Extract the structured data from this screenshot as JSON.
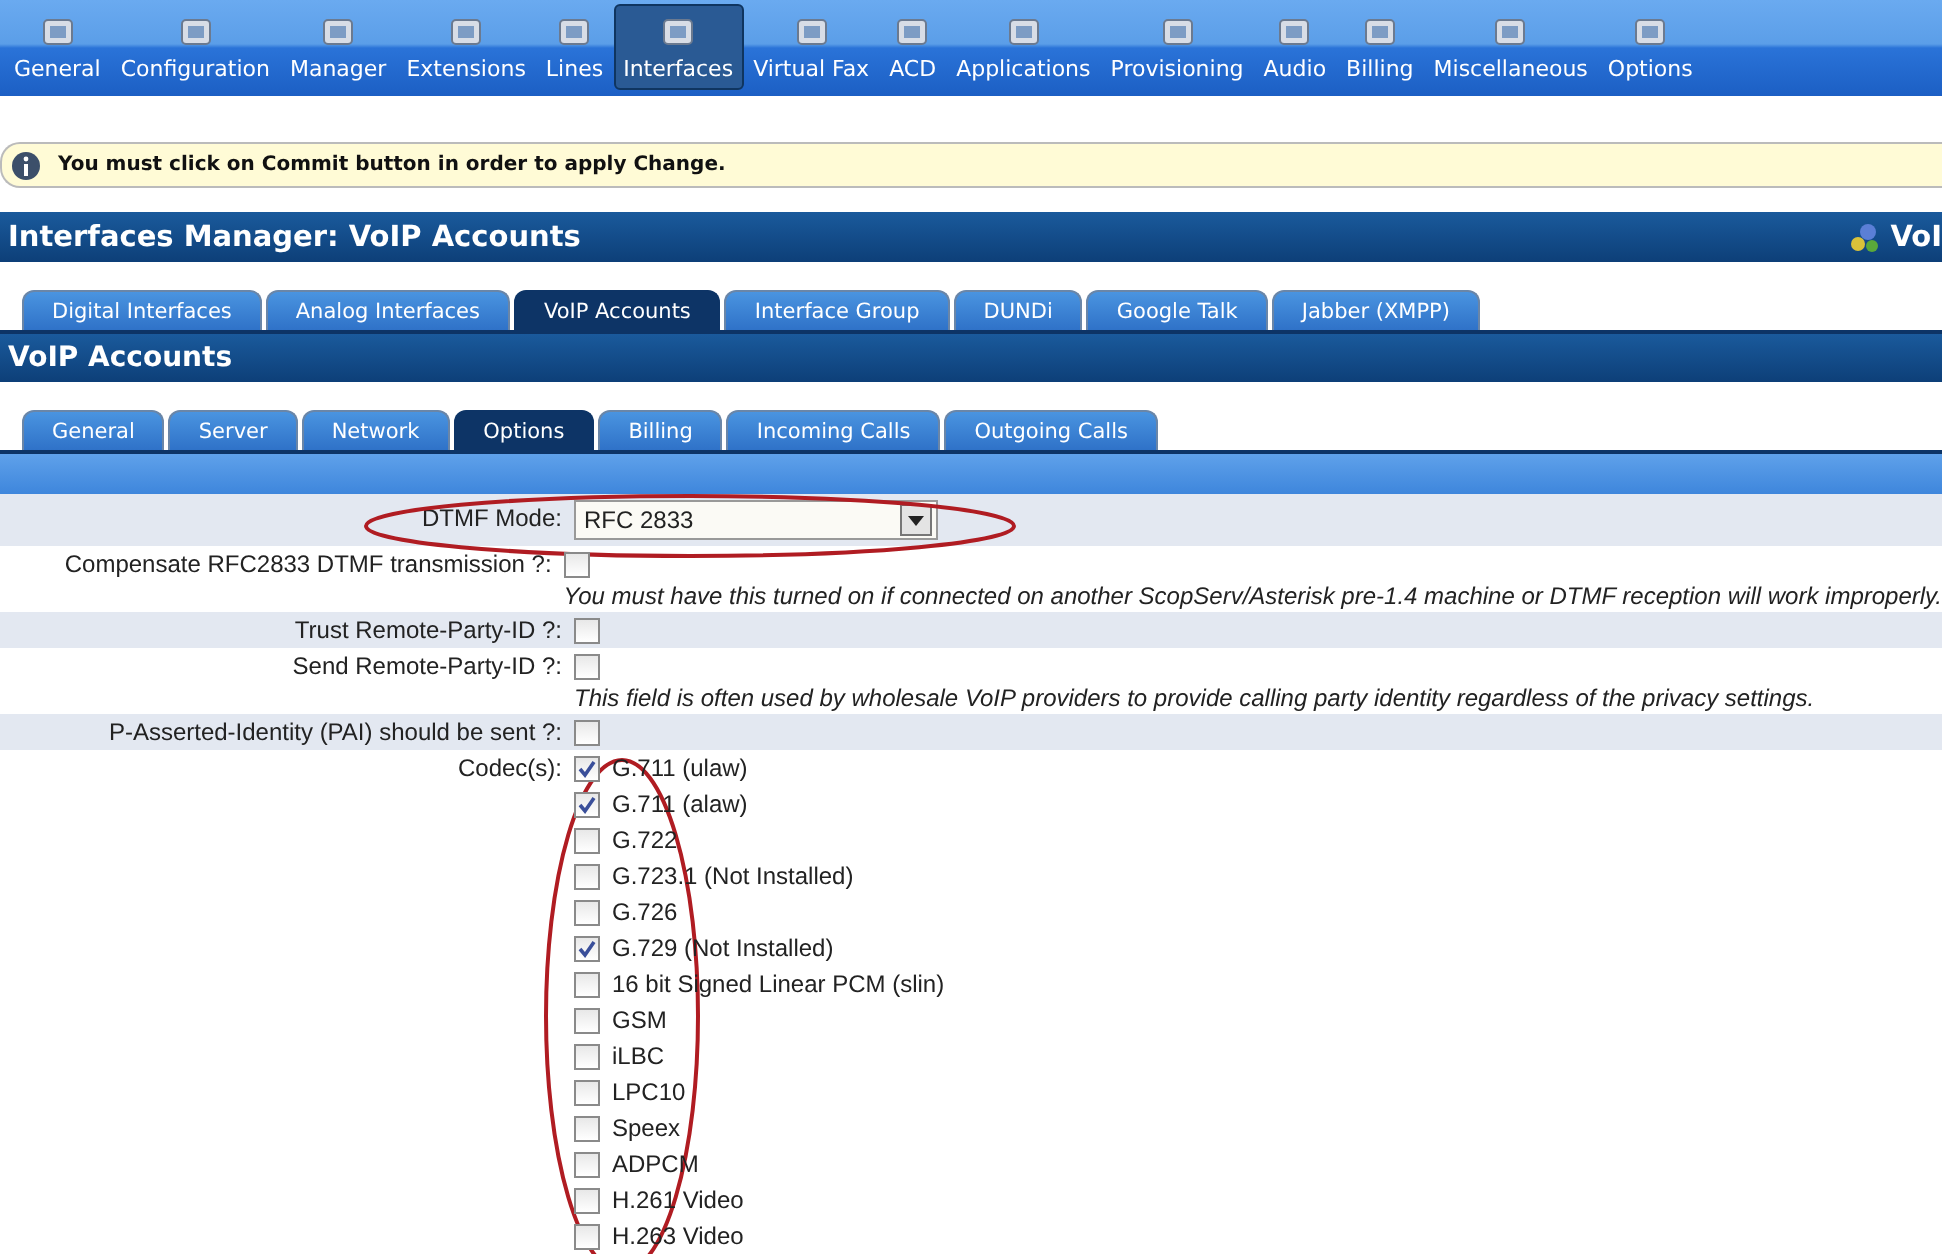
{
  "nav": [
    {
      "label": "General",
      "selected": false
    },
    {
      "label": "Configuration",
      "selected": false
    },
    {
      "label": "Manager",
      "selected": false
    },
    {
      "label": "Extensions",
      "selected": false
    },
    {
      "label": "Lines",
      "selected": false
    },
    {
      "label": "Interfaces",
      "selected": true
    },
    {
      "label": "Virtual Fax",
      "selected": false
    },
    {
      "label": "ACD",
      "selected": false
    },
    {
      "label": "Applications",
      "selected": false
    },
    {
      "label": "Provisioning",
      "selected": false
    },
    {
      "label": "Audio",
      "selected": false
    },
    {
      "label": "Billing",
      "selected": false
    },
    {
      "label": "Miscellaneous",
      "selected": false
    },
    {
      "label": "Options",
      "selected": false
    }
  ],
  "notice": "You must click on Commit button in order to apply Change.",
  "page_title": "Interfaces Manager:  VoIP Accounts",
  "page_title_right": "VoI",
  "tabs": [
    {
      "label": "Digital Interfaces",
      "selected": false
    },
    {
      "label": "Analog Interfaces",
      "selected": false
    },
    {
      "label": "VoIP Accounts",
      "selected": true
    },
    {
      "label": "Interface Group",
      "selected": false
    },
    {
      "label": "DUNDi",
      "selected": false
    },
    {
      "label": "Google Talk",
      "selected": false
    },
    {
      "label": "Jabber (XMPP)",
      "selected": false
    }
  ],
  "section_title": "VoIP Accounts",
  "subtabs": [
    {
      "label": "General",
      "selected": false
    },
    {
      "label": "Server",
      "selected": false
    },
    {
      "label": "Network",
      "selected": false
    },
    {
      "label": "Options",
      "selected": true
    },
    {
      "label": "Billing",
      "selected": false
    },
    {
      "label": "Incoming Calls",
      "selected": false
    },
    {
      "label": "Outgoing Calls",
      "selected": false
    }
  ],
  "form": [
    {
      "kind": "select",
      "label": "DTMF Mode:",
      "value": "RFC 2833"
    },
    {
      "kind": "checkbox",
      "label": "Compensate RFC2833 DTMF transmission ?:",
      "checked": false,
      "note": "You must have this turned on if connected on another ScopServ/Asterisk pre-1.4 machine or DTMF reception will work improperly."
    },
    {
      "kind": "checkbox",
      "label": "Trust Remote-Party-ID ?:",
      "checked": false
    },
    {
      "kind": "checkbox",
      "label": "Send Remote-Party-ID ?:",
      "checked": false,
      "note": "This field is often used by wholesale VoIP providers to provide calling party identity regardless of the privacy settings."
    },
    {
      "kind": "checkbox",
      "label": "P-Asserted-Identity (PAI) should be sent ?:",
      "checked": false
    },
    {
      "kind": "checklist",
      "label": "Codec(s):",
      "options": [
        {
          "label": "G.711 (ulaw)",
          "checked": true
        },
        {
          "label": "G.711 (alaw)",
          "checked": true
        },
        {
          "label": "G.722",
          "checked": false
        },
        {
          "label": "G.723.1 (Not Installed)",
          "checked": false
        },
        {
          "label": "G.726",
          "checked": false
        },
        {
          "label": "G.729 (Not Installed)",
          "checked": true
        },
        {
          "label": "16 bit Signed Linear PCM (slin)",
          "checked": false
        },
        {
          "label": "GSM",
          "checked": false
        },
        {
          "label": "iLBC",
          "checked": false
        },
        {
          "label": "LPC10",
          "checked": false
        },
        {
          "label": "Speex",
          "checked": false
        },
        {
          "label": "ADPCM",
          "checked": false
        },
        {
          "label": "H.261 Video",
          "checked": false
        },
        {
          "label": "H.263 Video",
          "checked": false
        }
      ]
    }
  ]
}
